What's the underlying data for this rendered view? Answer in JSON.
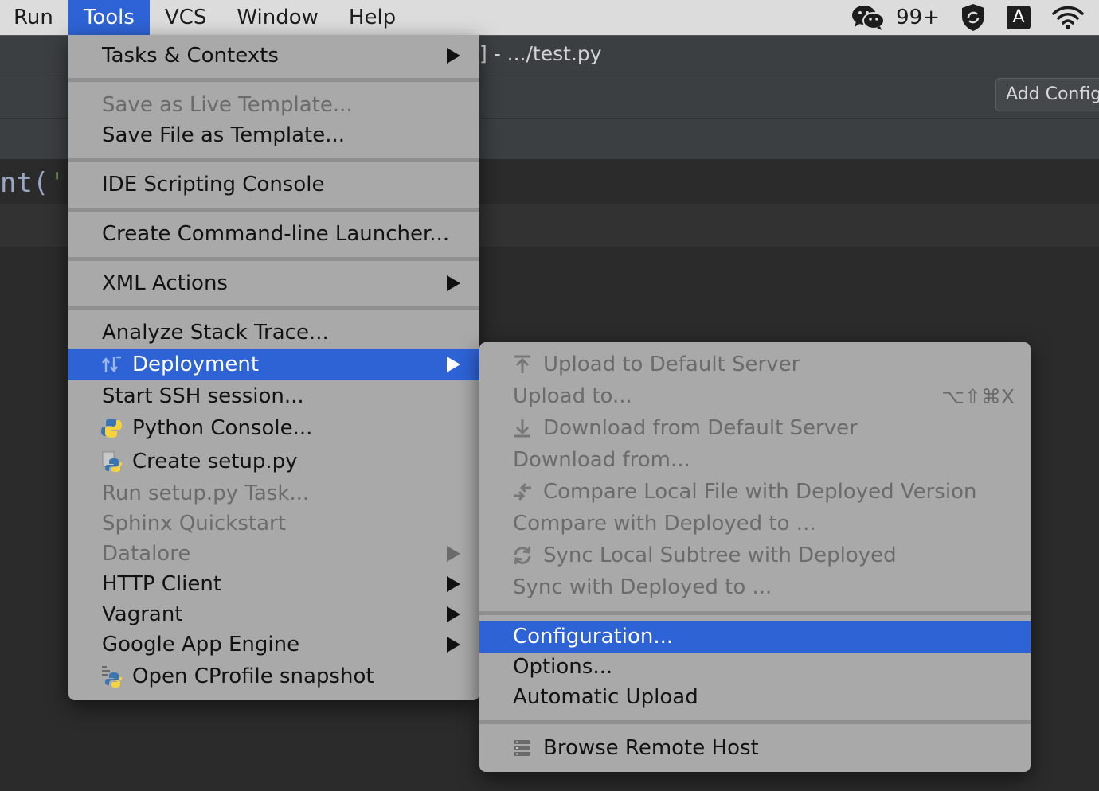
{
  "menubar": {
    "items": [
      "Run",
      "Tools",
      "VCS",
      "Window",
      "Help"
    ],
    "active": "Tools",
    "tray": {
      "notification_count": "99+",
      "input_source": "A"
    }
  },
  "ide": {
    "title_fragment": "] - .../test.py",
    "add_config_label": "Add Config",
    "code_prefix": "nt(",
    "code_quote": "'"
  },
  "tools_menu": {
    "tasks_contexts": "Tasks & Contexts",
    "save_live_template": "Save as Live Template...",
    "save_file_template": "Save File as Template...",
    "ide_scripting_console": "IDE Scripting Console",
    "create_cli_launcher": "Create Command-line Launcher...",
    "xml_actions": "XML Actions",
    "analyze_stack_trace": "Analyze Stack Trace...",
    "deployment": "Deployment",
    "start_ssh": "Start SSH session...",
    "python_console": "Python Console...",
    "create_setup": "Create setup.py",
    "run_setup_task": "Run setup.py Task...",
    "sphinx_quickstart": "Sphinx Quickstart",
    "datalore": "Datalore",
    "http_client": "HTTP Client",
    "vagrant": "Vagrant",
    "google_app_engine": "Google App Engine",
    "open_cprofile": "Open CProfile snapshot"
  },
  "deployment_menu": {
    "upload_default": "Upload to Default Server",
    "upload_to": "Upload to...",
    "upload_to_shortcut": "⌥⇧⌘X",
    "download_default": "Download from Default Server",
    "download_from": "Download from...",
    "compare_local": "Compare Local File with Deployed Version",
    "compare_with": "Compare with Deployed to ...",
    "sync_local": "Sync Local Subtree with Deployed",
    "sync_with": "Sync with Deployed to ...",
    "configuration": "Configuration...",
    "options": "Options...",
    "automatic_upload": "Automatic Upload",
    "browse_remote": "Browse Remote Host"
  },
  "colors": {
    "selection": "#2e63d6",
    "menu_bg": "#a9a9a9",
    "disabled_text": "#6b6b6b"
  }
}
